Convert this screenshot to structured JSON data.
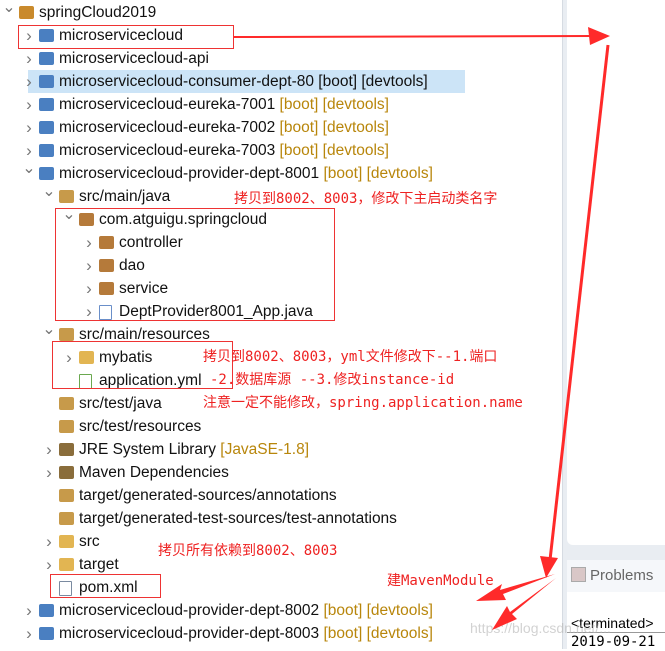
{
  "tree": [
    {
      "label": "springCloud2019",
      "decor": "",
      "level": 0,
      "arrow": "expanded",
      "icon": "working-set-icon"
    },
    {
      "label": "microservicecloud",
      "decor": "",
      "level": 1,
      "arrow": "collapsed",
      "icon": "maven-project-icon"
    },
    {
      "label": "microservicecloud-api",
      "decor": "",
      "level": 1,
      "arrow": "collapsed",
      "icon": "maven-project-icon"
    },
    {
      "label": "microservicecloud-consumer-dept-80 [boot] [devtools]",
      "decor": "",
      "level": 1,
      "arrow": "collapsed",
      "icon": "maven-project-warning-icon",
      "selected": true
    },
    {
      "label": "microservicecloud-eureka-7001",
      "decor": "[boot] [devtools]",
      "level": 1,
      "arrow": "collapsed",
      "icon": "maven-project-icon"
    },
    {
      "label": "microservicecloud-eureka-7002",
      "decor": "[boot] [devtools]",
      "level": 1,
      "arrow": "collapsed",
      "icon": "maven-project-icon"
    },
    {
      "label": "microservicecloud-eureka-7003",
      "decor": "[boot] [devtools]",
      "level": 1,
      "arrow": "collapsed",
      "icon": "maven-project-icon"
    },
    {
      "label": "microservicecloud-provider-dept-8001",
      "decor": "[boot] [devtools]",
      "level": 1,
      "arrow": "expanded",
      "icon": "maven-project-warning-icon"
    },
    {
      "label": "src/main/java",
      "decor": "",
      "level": 2,
      "arrow": "expanded",
      "icon": "source-folder-icon"
    },
    {
      "label": "com.atguigu.springcloud",
      "decor": "",
      "level": 3,
      "arrow": "expanded",
      "icon": "package-icon"
    },
    {
      "label": "controller",
      "decor": "",
      "level": 4,
      "arrow": "collapsed",
      "icon": "package-icon"
    },
    {
      "label": "dao",
      "decor": "",
      "level": 4,
      "arrow": "collapsed",
      "icon": "package-icon"
    },
    {
      "label": "service",
      "decor": "",
      "level": 4,
      "arrow": "collapsed",
      "icon": "package-icon"
    },
    {
      "label": "DeptProvider8001_App.java",
      "decor": "",
      "level": 4,
      "arrow": "collapsed",
      "icon": "java-file-icon"
    },
    {
      "label": "src/main/resources",
      "decor": "",
      "level": 2,
      "arrow": "expanded",
      "icon": "source-folder-icon"
    },
    {
      "label": "mybatis",
      "decor": "",
      "level": 3,
      "arrow": "collapsed",
      "icon": "folder-icon"
    },
    {
      "label": "application.yml",
      "decor": "",
      "level": 3,
      "arrow": "",
      "icon": "yml-file-icon"
    },
    {
      "label": "src/test/java",
      "decor": "",
      "level": 2,
      "arrow": "",
      "icon": "source-folder-icon"
    },
    {
      "label": "src/test/resources",
      "decor": "",
      "level": 2,
      "arrow": "",
      "icon": "source-folder-icon"
    },
    {
      "label": "JRE System Library",
      "decor": "[JavaSE-1.8]",
      "level": 2,
      "arrow": "collapsed",
      "icon": "library-icon"
    },
    {
      "label": "Maven Dependencies",
      "decor": "",
      "level": 2,
      "arrow": "collapsed",
      "icon": "library-icon"
    },
    {
      "label": "target/generated-sources/annotations",
      "decor": "",
      "level": 2,
      "arrow": "",
      "icon": "source-folder-icon"
    },
    {
      "label": "target/generated-test-sources/test-annotations",
      "decor": "",
      "level": 2,
      "arrow": "",
      "icon": "source-folder-icon"
    },
    {
      "label": "src",
      "decor": "",
      "level": 2,
      "arrow": "collapsed",
      "icon": "folder-icon"
    },
    {
      "label": "target",
      "decor": "",
      "level": 2,
      "arrow": "collapsed",
      "icon": "folder-icon"
    },
    {
      "label": "pom.xml",
      "decor": "",
      "level": 2,
      "arrow": "",
      "icon": "xml-file-icon"
    },
    {
      "label": "microservicecloud-provider-dept-8002",
      "decor": "[boot] [devtools]",
      "level": 1,
      "arrow": "collapsed",
      "icon": "maven-project-icon"
    },
    {
      "label": "microservicecloud-provider-dept-8003",
      "decor": "[boot] [devtools]",
      "level": 1,
      "arrow": "collapsed",
      "icon": "maven-project-icon"
    }
  ],
  "annotations": {
    "rename_main": "拷贝到8002、8003，修改下主启动类名字",
    "yml_line1": "拷贝到8002、8003，yml文件修改下--1.端口",
    "yml_line2": "-2.数据库源 --3.修改instance-id",
    "yml_line3": "注意一定不能修改，spring.application.name",
    "deps": "拷贝所有依赖到8002、8003",
    "new_module": "建MavenModule"
  },
  "right_panel": {
    "problems_tab": "Problems",
    "console_line1": "<terminated>",
    "console_line2": "2019-09-21"
  },
  "watermark": "https://blog.csdn.net/...",
  "colors": {
    "annotation": "#ee2222",
    "selection": "#cce4f7",
    "decoration": "#b8860b"
  }
}
